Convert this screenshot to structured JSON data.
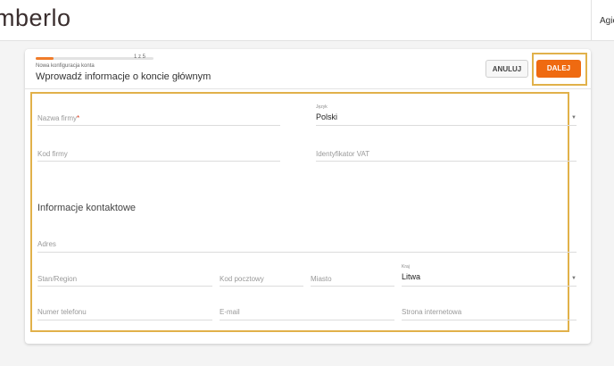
{
  "header": {
    "logo": "mberlo",
    "user": "Agie"
  },
  "wizard": {
    "progress": 0.15,
    "step": "1 z 5",
    "subtitle": "Nowa konfiguracja konta",
    "title": "Wprowadź informacje o koncie głównym",
    "cancel_label": "ANULUJ",
    "next_label": "DALEJ",
    "accent_color": "#ef6a11",
    "highlight_color": "#e1b14a"
  },
  "form": {
    "company_name_placeholder": "Nazwa firmy",
    "company_name_required": "*",
    "language_label": "Język",
    "language_value": "Polski",
    "company_code_placeholder": "Kod firmy",
    "vat_placeholder": "Identyfikator VAT",
    "contact_section": "Informacje kontaktowe",
    "address_placeholder": "Adres",
    "state_placeholder": "Stan/Region",
    "postal_placeholder": "Kod pocztowy",
    "city_placeholder": "Miasto",
    "country_label": "Kraj",
    "country_value": "Litwa",
    "phone_placeholder": "Numer telefonu",
    "email_placeholder": "E-mail",
    "website_placeholder": "Strona internetowa"
  }
}
